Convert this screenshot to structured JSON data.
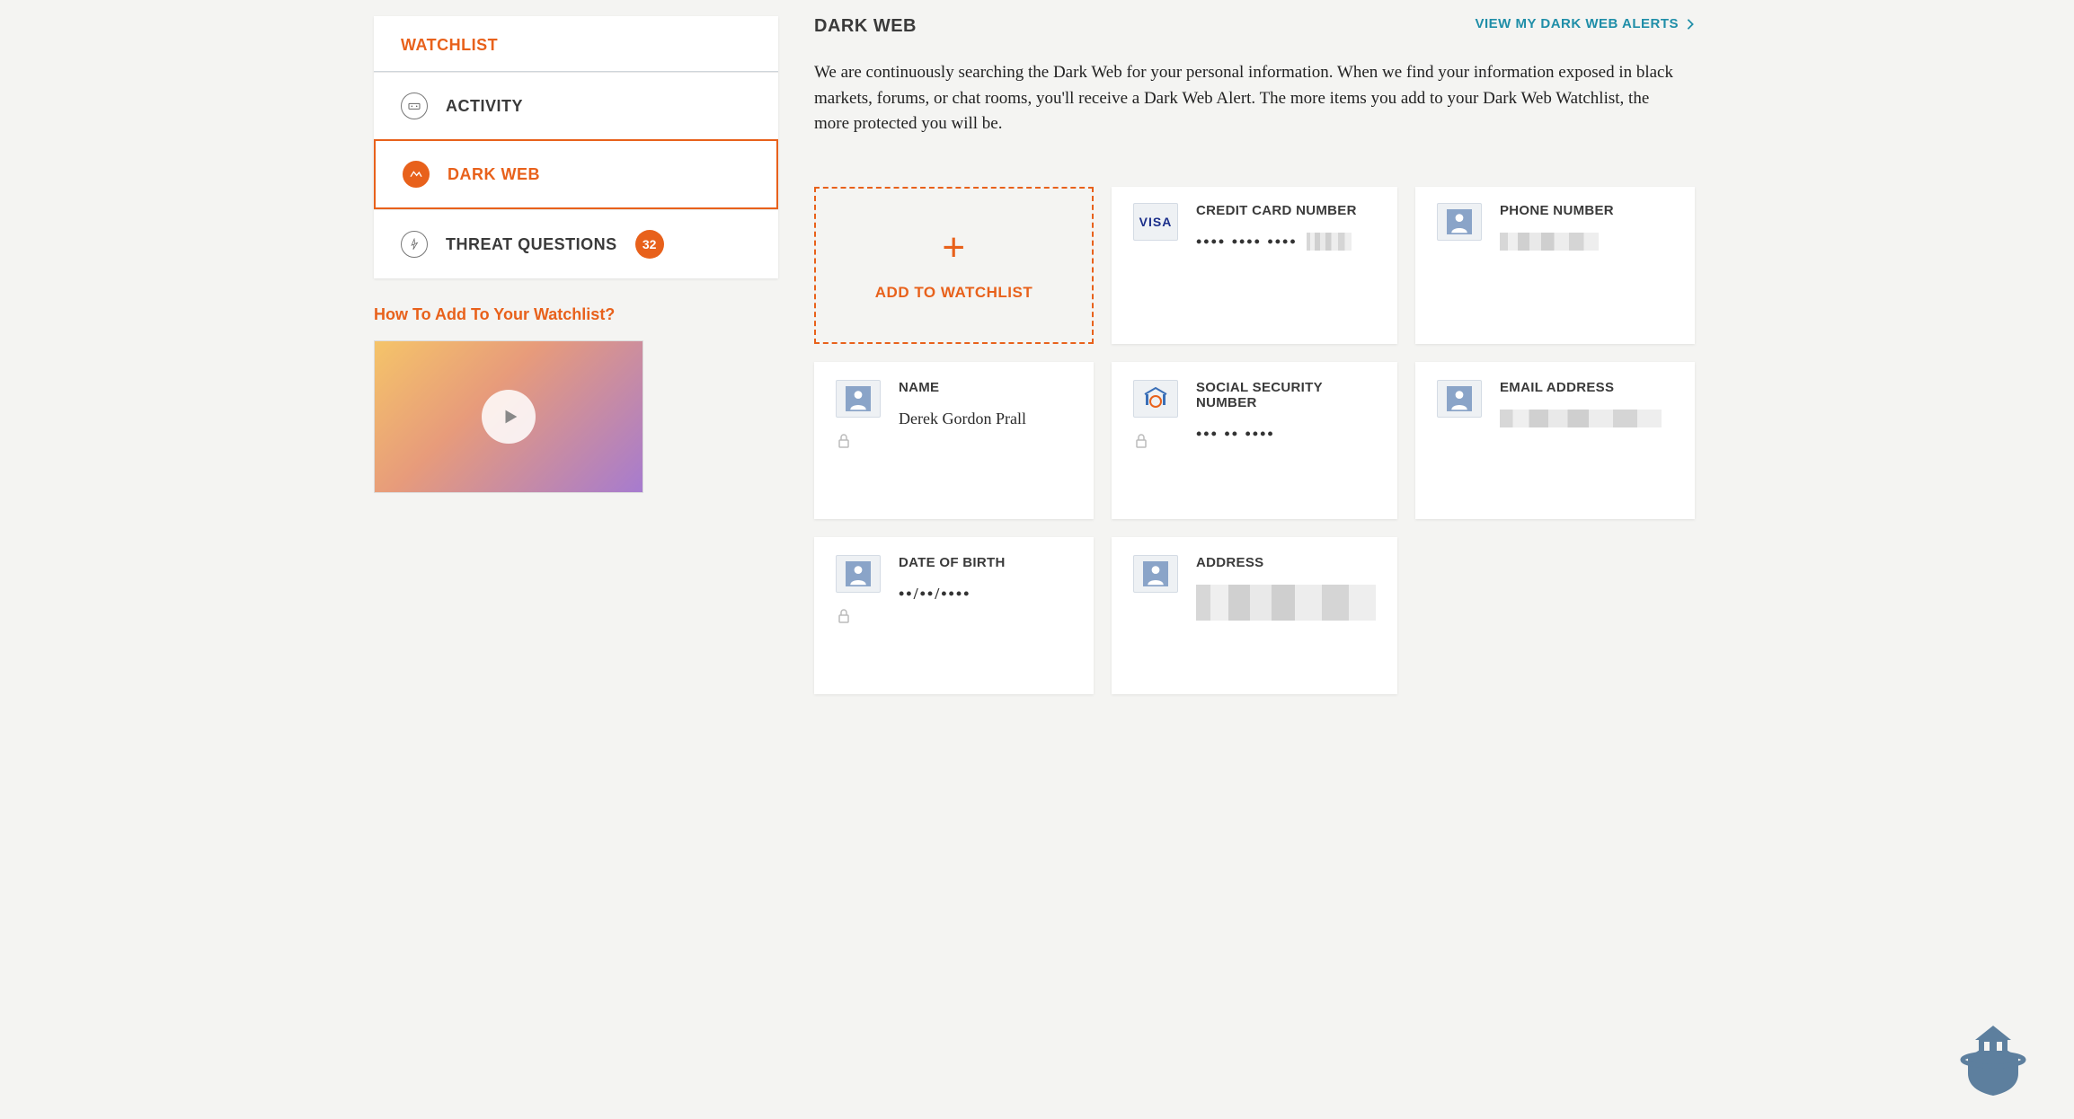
{
  "sidebar": {
    "title": "WATCHLIST",
    "items": [
      {
        "label": "ACTIVITY"
      },
      {
        "label": "DARK WEB"
      },
      {
        "label": "THREAT QUESTIONS",
        "badge": "32"
      }
    ],
    "howto": "How To Add To Your Watchlist?"
  },
  "main": {
    "title": "DARK WEB",
    "alerts_link": "VIEW MY DARK WEB ALERTS",
    "description": "We are continuously searching the Dark Web for your personal information. When we find your information exposed in black markets, forums, or chat rooms, you'll receive a Dark Web Alert. The more items you add to your Dark Web Watchlist, the more protected you will be.",
    "add_label": "ADD TO WATCHLIST",
    "cards": {
      "credit_card": {
        "label": "CREDIT CARD NUMBER",
        "masked": "•••• •••• ••••"
      },
      "phone": {
        "label": "PHONE NUMBER"
      },
      "name": {
        "label": "NAME",
        "value": "Derek Gordon Prall"
      },
      "ssn": {
        "label": "SOCIAL SECURITY NUMBER",
        "masked": "••• •• ••••"
      },
      "email": {
        "label": "EMAIL ADDRESS"
      },
      "dob": {
        "label": "DATE OF BIRTH",
        "masked": "••/••/••••"
      },
      "address": {
        "label": "ADDRESS"
      }
    }
  }
}
